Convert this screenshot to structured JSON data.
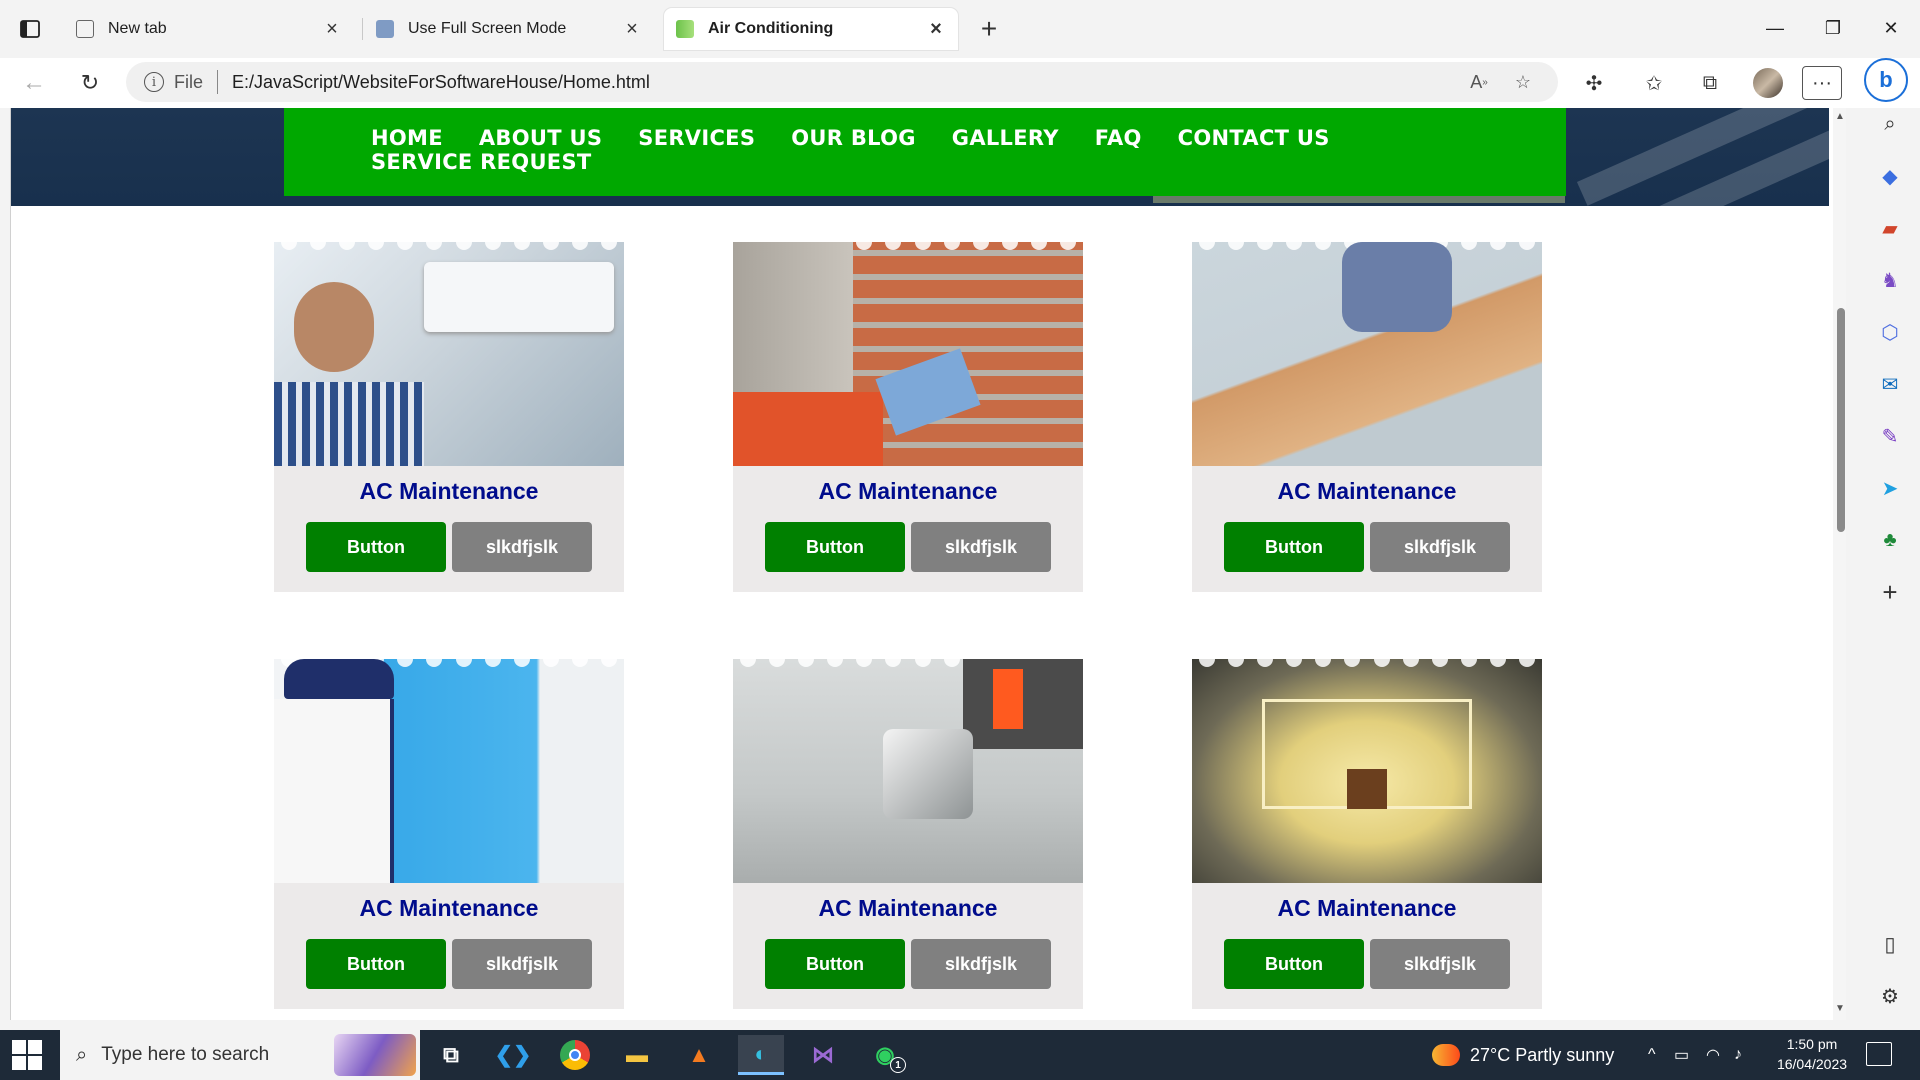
{
  "browser": {
    "tabs": [
      {
        "title": "New tab",
        "active": false
      },
      {
        "title": "Use Full Screen Mode",
        "active": false
      },
      {
        "title": "Air Conditioning",
        "active": true
      }
    ],
    "address": {
      "scheme": "File",
      "url": "E:/JavaScript/WebsiteForSoftwareHouse/Home.html"
    }
  },
  "site": {
    "nav": [
      "HOME",
      "ABOUT US",
      "SERVICES",
      "OUR BLOG",
      "GALLERY",
      "FAQ",
      "CONTACT US",
      "SERVICE REQUEST"
    ],
    "cards": [
      {
        "title": "AC Maintenance",
        "primary_label": "Button",
        "secondary_label": "slkdfjslk",
        "image": "ac-technician"
      },
      {
        "title": "AC Maintenance",
        "primary_label": "Button",
        "secondary_label": "slkdfjslk",
        "image": "brick-plastering"
      },
      {
        "title": "AC Maintenance",
        "primary_label": "Button",
        "secondary_label": "slkdfjslk",
        "image": "wood-flooring"
      },
      {
        "title": "AC Maintenance",
        "primary_label": "Button",
        "secondary_label": "slkdfjslk",
        "image": "wall-painting"
      },
      {
        "title": "AC Maintenance",
        "primary_label": "Button",
        "secondary_label": "slkdfjslk",
        "image": "plumbing-tap"
      },
      {
        "title": "AC Maintenance",
        "primary_label": "Button",
        "secondary_label": "slkdfjslk",
        "image": "ceiling-lights"
      }
    ],
    "colors": {
      "nav_bg": "#00a800",
      "card_title": "#000c8c",
      "primary_button": "#008000",
      "secondary_button": "#808080"
    }
  },
  "taskbar": {
    "search_placeholder": "Type here to search",
    "weather": "27°C  Partly sunny",
    "time": "1:50 pm",
    "date": "16/04/2023",
    "whatsapp_badge": "1"
  }
}
